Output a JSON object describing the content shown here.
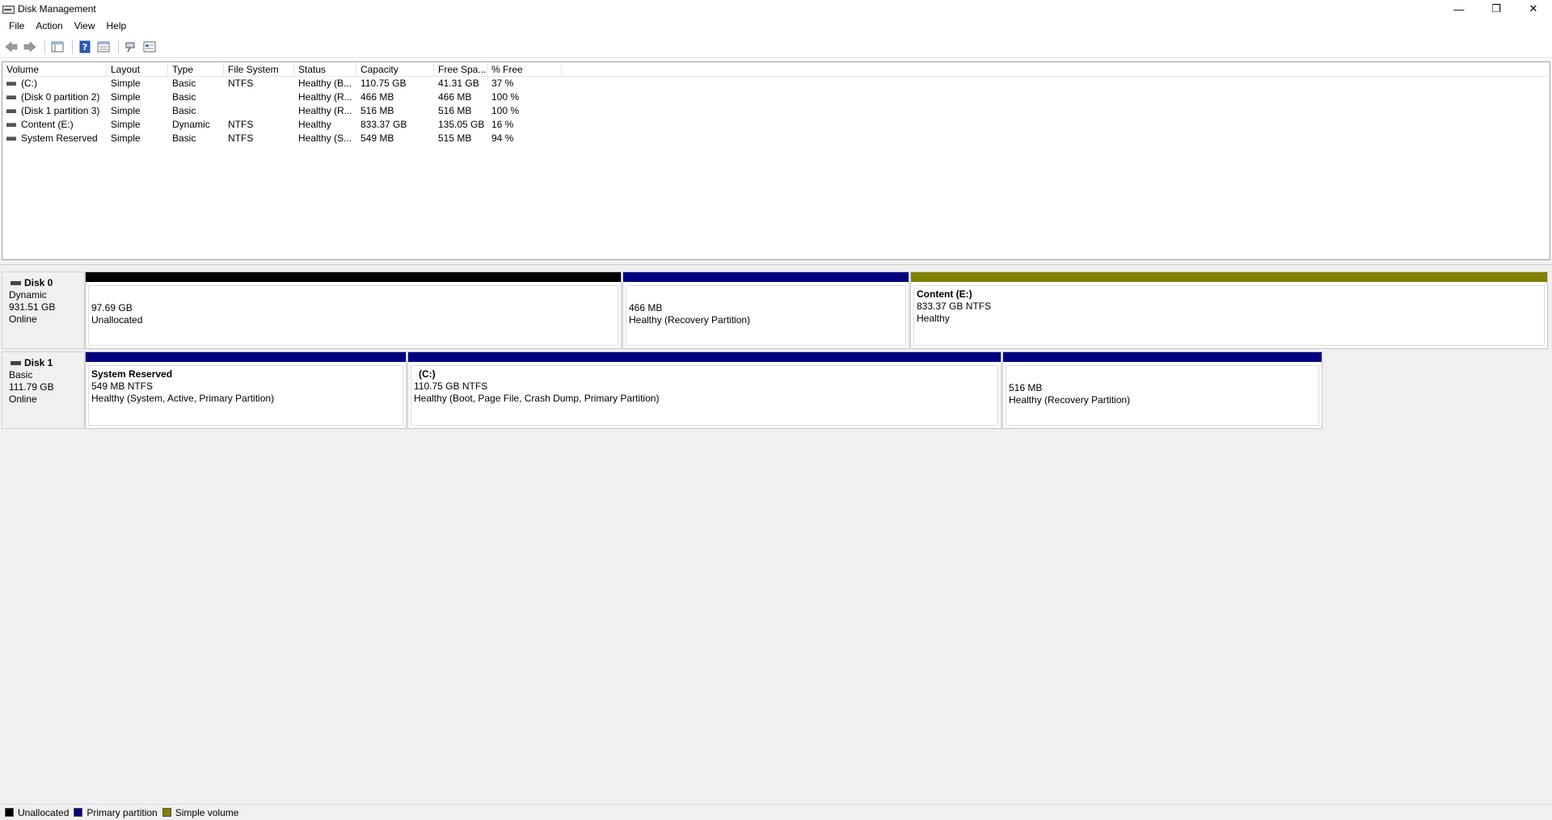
{
  "window": {
    "title": "Disk Management",
    "controls": {
      "minimize": "—",
      "restore": "❐",
      "close": "✕"
    }
  },
  "menu": [
    "File",
    "Action",
    "View",
    "Help"
  ],
  "toolbar": {
    "icons": [
      "back-icon",
      "forward-icon",
      "console-tree-icon",
      "help-icon",
      "properties-icon",
      "connect-icon",
      "settings-icon"
    ]
  },
  "volume_list": {
    "columns": [
      "Volume",
      "Layout",
      "Type",
      "File System",
      "Status",
      "Capacity",
      "Free Spa...",
      "% Free"
    ],
    "rows": [
      [
        "(C:)",
        "Simple",
        "Basic",
        "NTFS",
        "Healthy (B...",
        "110.75 GB",
        "41.31 GB",
        "37 %"
      ],
      [
        "(Disk 0 partition 2)",
        "Simple",
        "Basic",
        "",
        "Healthy (R...",
        "466 MB",
        "466 MB",
        "100 %"
      ],
      [
        "(Disk 1 partition 3)",
        "Simple",
        "Basic",
        "",
        "Healthy (R...",
        "516 MB",
        "516 MB",
        "100 %"
      ],
      [
        "Content (E:)",
        "Simple",
        "Dynamic",
        "NTFS",
        "Healthy",
        "833.37 GB",
        "135.05 GB",
        "16 %"
      ],
      [
        "System Reserved",
        "Simple",
        "Basic",
        "NTFS",
        "Healthy (S...",
        "549 MB",
        "515 MB",
        "94 %"
      ]
    ]
  },
  "disks": [
    {
      "name": "Disk 0",
      "type": "Dynamic",
      "size": "931.51 GB",
      "status": "Online",
      "partitions": [
        {
          "title": "",
          "line1": "97.69 GB",
          "line2": "Unallocated",
          "color": "#000000"
        },
        {
          "title": "",
          "line1": "466 MB",
          "line2": "Healthy (Recovery Partition)",
          "color": "#00007f"
        },
        {
          "title": "Content  (E:)",
          "line1": "833.37 GB NTFS",
          "line2": "Healthy",
          "color": "#808000"
        }
      ]
    },
    {
      "name": "Disk 1",
      "type": "Basic",
      "size": "111.79 GB",
      "status": "Online",
      "partitions": [
        {
          "title": "System Reserved",
          "line1": "549 MB NTFS",
          "line2": "Healthy (System, Active, Primary Partition)",
          "color": "#00007f"
        },
        {
          "title": "(C:)",
          "line1": "110.75 GB NTFS",
          "line2": "Healthy (Boot, Page File, Crash Dump, Primary Partition)",
          "color": "#00007f"
        },
        {
          "title": "",
          "line1": "516 MB",
          "line2": "Healthy (Recovery Partition)",
          "color": "#00007f"
        }
      ]
    }
  ],
  "legend": [
    {
      "label": "Unallocated",
      "color": "#000000"
    },
    {
      "label": "Primary partition",
      "color": "#00007f"
    },
    {
      "label": "Simple volume",
      "color": "#808000"
    }
  ]
}
